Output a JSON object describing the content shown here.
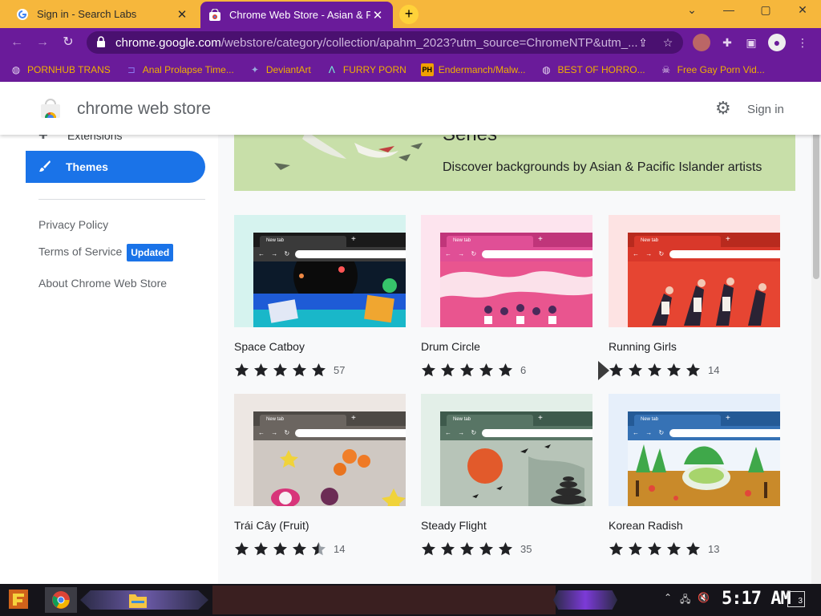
{
  "browser": {
    "tabs": [
      {
        "title": "Sign in - Search Labs",
        "close": "✕"
      },
      {
        "title": "Chrome Web Store - Asian & Pacific",
        "close": "✕"
      }
    ],
    "new_tab": "+",
    "window_controls": {
      "minimize": "—",
      "maximize": "▢",
      "close": "✕",
      "tab_list": "⌄"
    },
    "url": {
      "host": "chrome.google.com",
      "path": "/webstore/category/collection/apahm_2023?utm_source=ChromeNTP&utm_..."
    },
    "accent_color": "#6a1b9a",
    "tabstrip_color": "#f6b73c"
  },
  "bookmarks": [
    {
      "label": "PORNHUB TRANS",
      "icon": "globe-icon"
    },
    {
      "label": "Anal Prolapse Time...",
      "icon": "bookmark-icon"
    },
    {
      "label": "DeviantArt",
      "icon": "deviantart-icon"
    },
    {
      "label": "FURRY PORN",
      "icon": "a-logo-icon"
    },
    {
      "label": "Endermanch/Malw...",
      "icon": "ph-icon",
      "icon_text": "PH"
    },
    {
      "label": "BEST OF HORRO...",
      "icon": "globe-icon"
    },
    {
      "label": "Free Gay Porn Vid...",
      "icon": "skull-icon"
    }
  ],
  "store": {
    "title": "chrome web store",
    "sign_in": "Sign in"
  },
  "sidebar": {
    "extensions": "Extensions",
    "themes": "Themes",
    "links": [
      "Privacy Policy",
      "Terms of Service",
      "About Chrome Web Store"
    ],
    "updated_badge": "Updated"
  },
  "banner": {
    "heading": "Series",
    "subtitle": "Discover backgrounds by Asian & Pacific Islander artists"
  },
  "themes": [
    {
      "name": "Space Catboy",
      "rating": 5,
      "count": "57",
      "frame": "#1a1a1a",
      "tab": "#3a3a3a",
      "bg": "#d6f3ef",
      "art": "space"
    },
    {
      "name": "Drum Circle",
      "rating": 5,
      "count": "6",
      "frame": "#c0357a",
      "tab": "#e04f96",
      "bg": "#fde4ee",
      "art": "drum"
    },
    {
      "name": "Running Girls",
      "rating": 5,
      "count": "14",
      "frame": "#b82a1e",
      "tab": "#d9382a",
      "bg": "#fde3e3",
      "art": "running"
    },
    {
      "name": "Trái Cây (Fruit)",
      "rating": 4.5,
      "count": "14",
      "frame": "#4d4945",
      "tab": "#6b6560",
      "bg": "#ede7e3",
      "art": "fruit"
    },
    {
      "name": "Steady Flight",
      "rating": 5,
      "count": "35",
      "frame": "#3e5a4c",
      "tab": "#587565",
      "bg": "#e3efe8",
      "art": "flight"
    },
    {
      "name": "Korean Radish",
      "rating": 5,
      "count": "13",
      "frame": "#245a96",
      "tab": "#3672b5",
      "bg": "#e6effa",
      "art": "radish"
    }
  ],
  "thumb_labels": {
    "new_tab": "New tab",
    "plus": "+",
    "nav": "← → ↻"
  },
  "taskbar": {
    "clock": "5:17 AM",
    "notifications": "3"
  }
}
